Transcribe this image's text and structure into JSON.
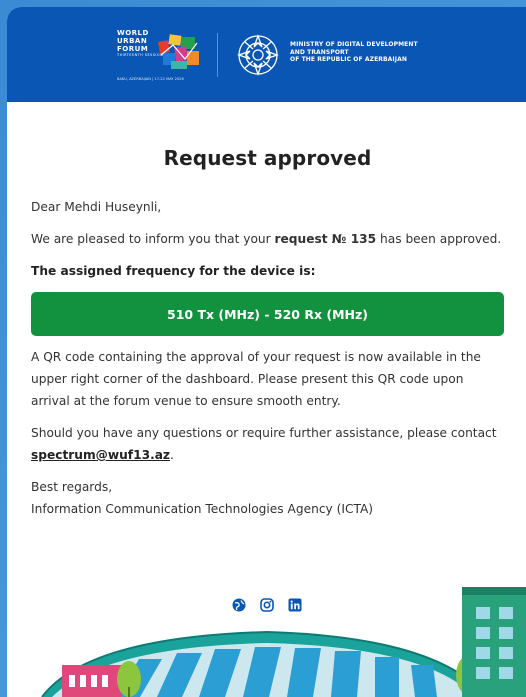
{
  "header": {
    "wuf_lines": [
      "WORLD",
      "URBAN",
      "FORUM",
      "THIRTEENTH SESSION"
    ],
    "wuf_sub": "BAKU, AZERBAIJAN | 17-22 MAY 2026",
    "ministry_lines": [
      "MINISTRY OF DIGITAL DEVELOPMENT",
      "AND TRANSPORT",
      "OF THE REPUBLIC OF AZERBAIJAN"
    ]
  },
  "email": {
    "title": "Request approved",
    "greeting": "Dear Mehdi Huseynli,",
    "approved_prefix": "We are pleased to inform you that your ",
    "request_label": "request № 135",
    "approved_suffix": " has been approved.",
    "freq_label": "The assigned frequency for the device is:",
    "frequency": "510 Tx (MHz) - 520 Rx (MHz)",
    "qr_text": "A QR code containing the approval of your request is now available in the upper right corner of the dashboard. Please present this QR code upon arrival at the forum venue to ensure smooth entry.",
    "contact_prefix": "Should you have any questions or require further assistance, please contact",
    "contact_email": "spectrum@wuf13.az",
    "contact_suffix": ".",
    "regards": "Best regards,",
    "signature": "Information Communication Technologies Agency (ICTA)"
  },
  "socials": [
    "globe-icon",
    "instagram-icon",
    "linkedin-icon"
  ],
  "colors": {
    "header_bg": "#0a56b4",
    "freq_bg": "#12923f",
    "page_bg": "#3d8fd6"
  }
}
